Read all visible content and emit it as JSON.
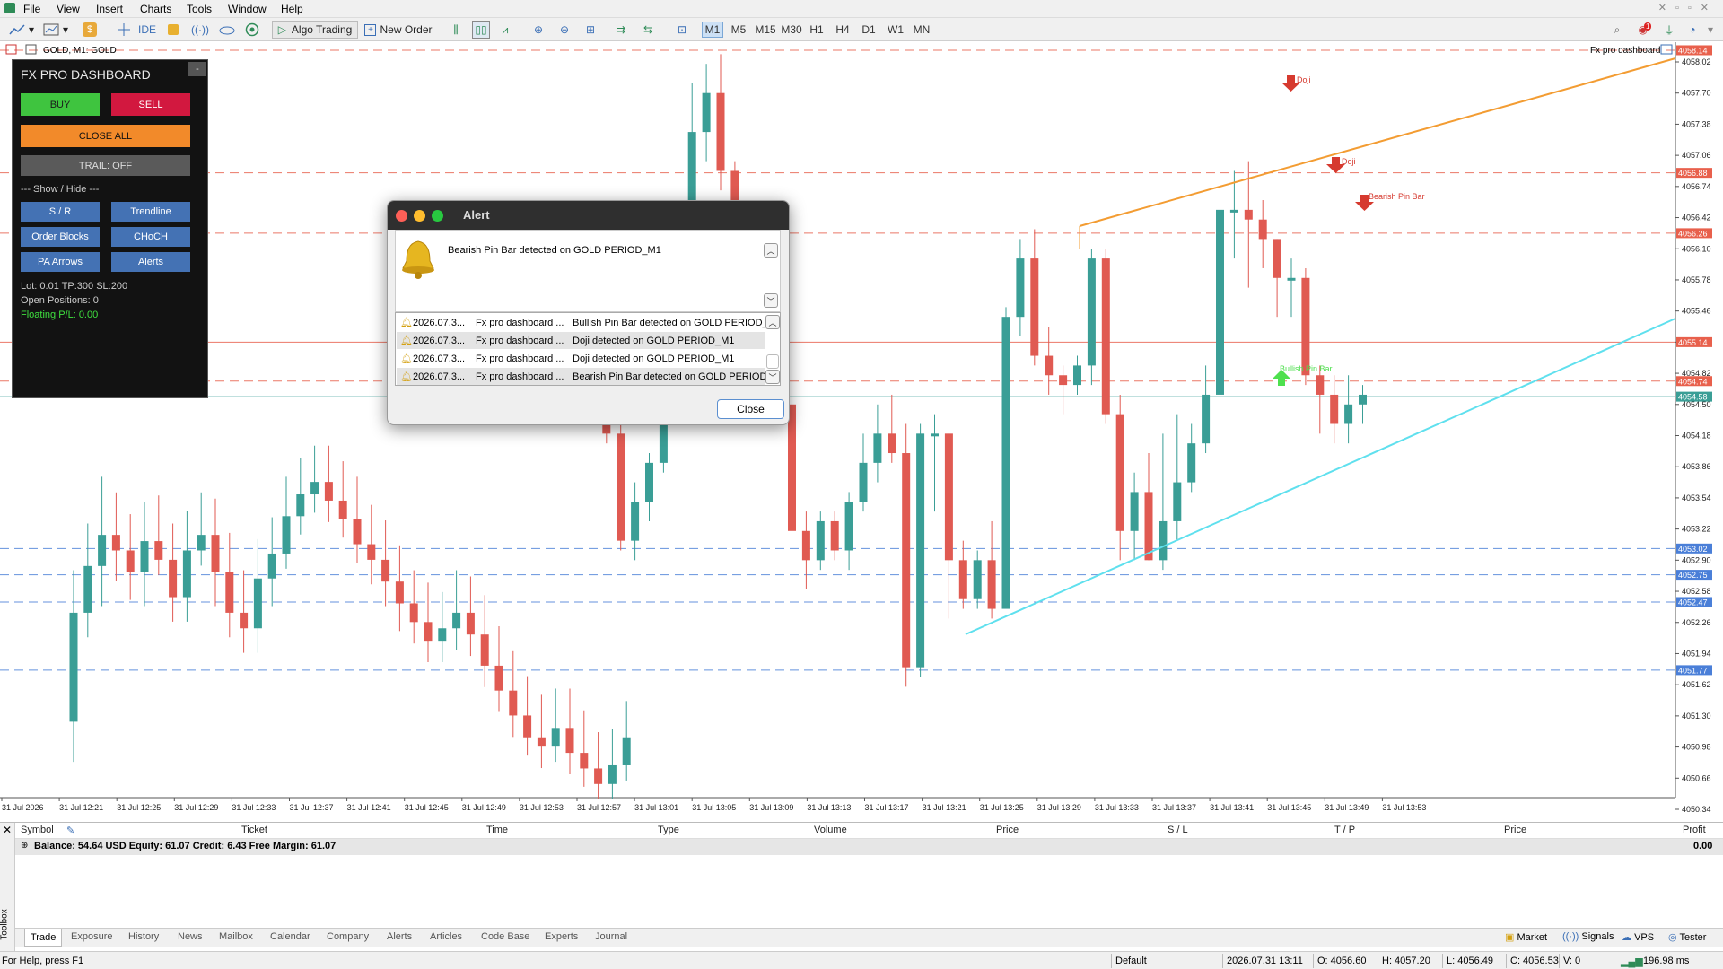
{
  "menu": [
    "File",
    "View",
    "Insert",
    "Charts",
    "Tools",
    "Window",
    "Help"
  ],
  "toolbar": {
    "ide": "IDE",
    "algo_trading": "Algo Trading",
    "new_order": "New Order",
    "timeframes": [
      "M1",
      "M5",
      "M15",
      "M30",
      "H1",
      "H4",
      "D1",
      "W1",
      "MN"
    ],
    "active_timeframe": "M1",
    "notification_count": "1"
  },
  "chart": {
    "symbol_label": "GOLD, M1:  GOLD",
    "indicator_label": "Fx pro dashboard",
    "price_axis": [
      "4058.02",
      "4057.70",
      "4057.38",
      "4057.06",
      "4056.74",
      "4056.42",
      "4056.10",
      "4055.78",
      "4055.46",
      "4055.14",
      "4054.82",
      "4054.50",
      "4054.18",
      "4053.86",
      "4053.54",
      "4053.22",
      "4052.90",
      "4052.58",
      "4052.26",
      "4051.94",
      "4051.62",
      "4051.30",
      "4050.98",
      "4050.66",
      "4050.34"
    ],
    "price_tags": [
      {
        "label": "4058.14",
        "color": "#e8604c"
      },
      {
        "label": "4056.88",
        "color": "#e8604c"
      },
      {
        "label": "4056.26",
        "color": "#e8604c"
      },
      {
        "label": "4055.14",
        "color": "#e8604c"
      },
      {
        "label": "4054.74",
        "color": "#e8604c"
      },
      {
        "label": "4054.58",
        "color": "#3a9e96"
      },
      {
        "label": "4053.02",
        "color": "#4a7fd8"
      },
      {
        "label": "4052.75",
        "color": "#4a7fd8"
      },
      {
        "label": "4052.47",
        "color": "#4a7fd8"
      },
      {
        "label": "4051.77",
        "color": "#4a7fd8"
      }
    ],
    "time_axis": [
      "31 Jul 2026",
      "31 Jul 12:21",
      "31 Jul 12:25",
      "31 Jul 12:29",
      "31 Jul 12:33",
      "31 Jul 12:37",
      "31 Jul 12:41",
      "31 Jul 12:45",
      "31 Jul 12:49",
      "31 Jul 12:53",
      "31 Jul 12:57",
      "31 Jul 13:01",
      "31 Jul 13:05",
      "31 Jul 13:09",
      "31 Jul 13:13",
      "31 Jul 13:17",
      "31 Jul 13:21",
      "31 Jul 13:25",
      "31 Jul 13:29",
      "31 Jul 13:33",
      "31 Jul 13:37",
      "31 Jul 13:41",
      "31 Jul 13:45",
      "31 Jul 13:49",
      "31 Jul 13:53"
    ],
    "annotations": {
      "doji1": "Doji",
      "doji2": "Doji",
      "bearish_pin": "Bearish Pin Bar",
      "bullish_pin": "Bullish Pin Bar"
    },
    "colors": {
      "bull": "#3a9e96",
      "bear": "#e05a52",
      "trend_upper": "#f39c32",
      "trend_lower": "#5fe0ee"
    }
  },
  "dashboard": {
    "title": "FX PRO DASHBOARD",
    "minimize": "-",
    "buy": "BUY",
    "sell": "SELL",
    "close_all": "CLOSE ALL",
    "trail": "TRAIL: OFF",
    "show_hide": "--- Show / Hide ---",
    "sr": "S / R",
    "trendline": "Trendline",
    "order_blocks": "Order Blocks",
    "choch": "CHoCH",
    "pa_arrows": "PA Arrows",
    "alerts": "Alerts",
    "lot_info": "Lot: 0.01  TP:300 SL:200",
    "open_positions": "Open Positions: 0",
    "floating_pl": "Floating P/L: 0.00"
  },
  "alert": {
    "title": "Alert",
    "message": "Bearish Pin Bar detected on GOLD PERIOD_M1",
    "rows": [
      {
        "time": "2026.07.3...",
        "source": "Fx pro dashboard ...",
        "text": "Bullish Pin Bar detected on GOLD PERIOD_M1"
      },
      {
        "time": "2026.07.3...",
        "source": "Fx pro dashboard ...",
        "text": "Doji detected on GOLD PERIOD_M1"
      },
      {
        "time": "2026.07.3...",
        "source": "Fx pro dashboard ...",
        "text": "Doji detected on GOLD PERIOD_M1"
      },
      {
        "time": "2026.07.3...",
        "source": "Fx pro dashboard ...",
        "text": "Bearish Pin Bar detected on GOLD PERIOD_..."
      }
    ],
    "close": "Close"
  },
  "terminal": {
    "columns": [
      "Symbol",
      "Ticket",
      "Time",
      "Type",
      "Volume",
      "Price",
      "S / L",
      "T / P",
      "Price",
      "Profit"
    ],
    "balance_line": "Balance: 54.64 USD  Equity: 61.07  Credit: 6.43  Free Margin: 61.07",
    "profit_total": "0.00",
    "toolbox": "Toolbox",
    "tabs": [
      "Trade",
      "Exposure",
      "History",
      "News",
      "Mailbox",
      "Calendar",
      "Company",
      "Alerts",
      "Articles",
      "Code Base",
      "Experts",
      "Journal"
    ],
    "active_tab": "Trade",
    "right_tabs": [
      "Market",
      "Signals",
      "VPS",
      "Tester"
    ]
  },
  "status": {
    "help": "For Help, press F1",
    "profile": "Default",
    "datetime": "2026.07.31 13:11",
    "open": "O: 4056.60",
    "high": "H: 4057.20",
    "low": "L: 4056.49",
    "close": "C: 4056.53",
    "volume": "V: 0",
    "ping": "196.98 ms"
  }
}
